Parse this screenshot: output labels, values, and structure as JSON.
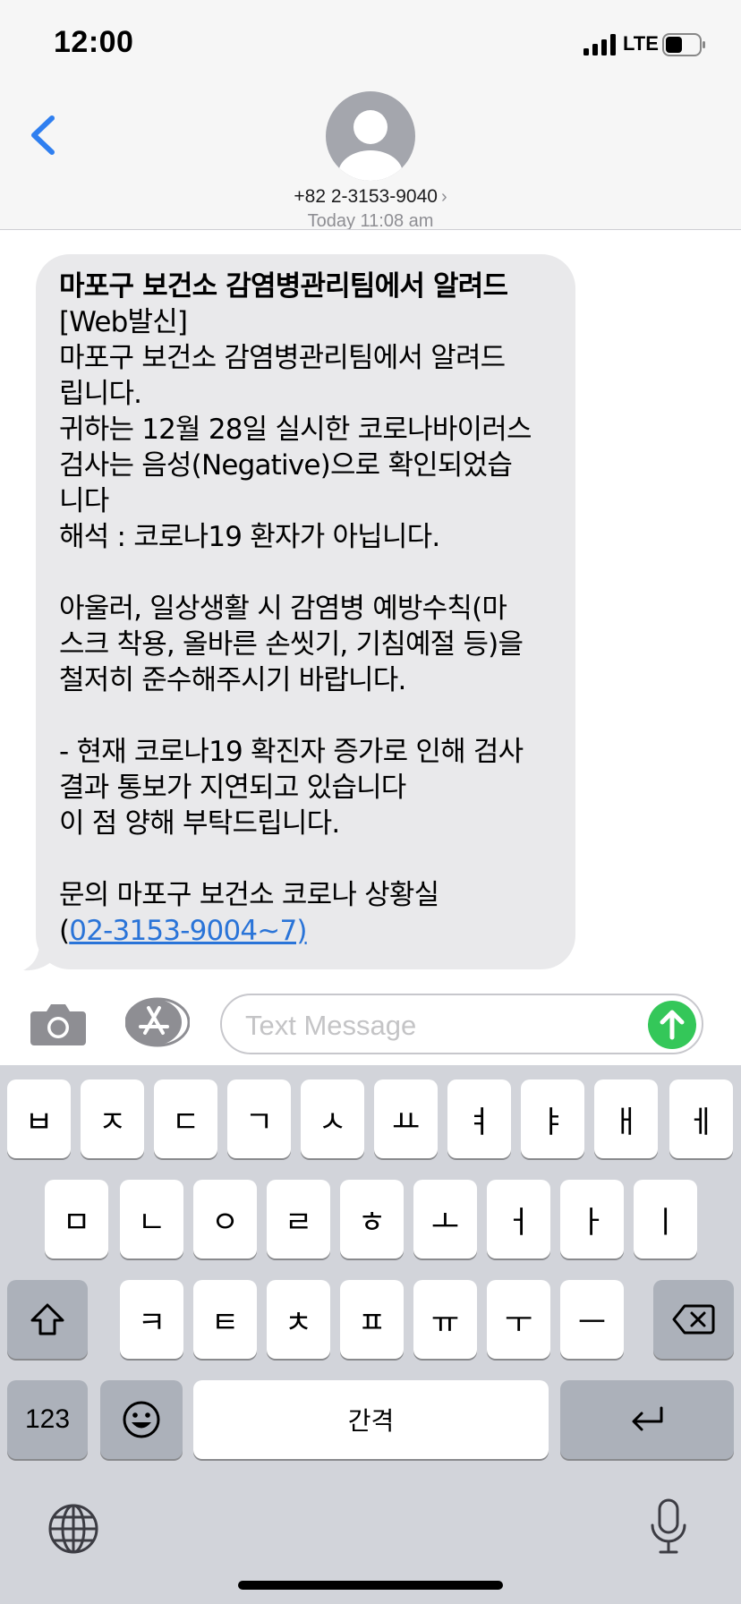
{
  "status_bar": {
    "time": "12:00",
    "network": "LTE"
  },
  "header": {
    "contact": "+82 2-3153-9040",
    "timestamp": "Today 11:08 am"
  },
  "message": {
    "title_line": "마포구 보건소 감염병관리팀에서 알려드",
    "body": "[Web발신]\n마포구 보건소 감염병관리팀에서 알려드\n립니다.\n귀하는 12월 28일 실시한 코로나바이러스\n검사는 음성(Negative)으로 확인되었습\n니다\n해석 : 코로나19 환자가 아닙니다.\n\n아울러, 일상생활 시 감염병 예방수칙(마\n스크 착용, 올바른 손씻기, 기침예절 등)을\n철저히 준수해주시기 바랍니다.\n\n- 현재 코로나19 확진자 증가로 인해 검사\n결과 통보가 지연되고 있습니다\n이 점 양해 부탁드립니다.\n\n문의 마포구 보건소 코로나 상황실\n(",
    "phone_link": "02-3153-9004~7)"
  },
  "input": {
    "placeholder": "Text Message"
  },
  "keyboard": {
    "row1": [
      "ㅂ",
      "ㅈ",
      "ㄷ",
      "ㄱ",
      "ㅅ",
      "ㅛ",
      "ㅕ",
      "ㅑ",
      "ㅐ",
      "ㅔ"
    ],
    "row2": [
      "ㅁ",
      "ㄴ",
      "ㅇ",
      "ㄹ",
      "ㅎ",
      "ㅗ",
      "ㅓ",
      "ㅏ",
      "ㅣ"
    ],
    "row3": [
      "ㅋ",
      "ㅌ",
      "ㅊ",
      "ㅍ",
      "ㅠ",
      "ㅜ",
      "ㅡ"
    ],
    "numbers_label": "123",
    "space_label": "간격"
  },
  "colors": {
    "accent": "#2f7ff0",
    "send": "#34c759",
    "bubble": "#e9e9eb",
    "keyboard_bg": "#d2d4da",
    "link": "#2a74d8"
  },
  "icons": [
    "back-chevron-icon",
    "contact-avatar-icon",
    "camera-icon",
    "app-store-icon",
    "send-arrow-icon",
    "shift-icon",
    "delete-icon",
    "emoji-icon",
    "return-icon",
    "globe-icon",
    "microphone-icon"
  ]
}
